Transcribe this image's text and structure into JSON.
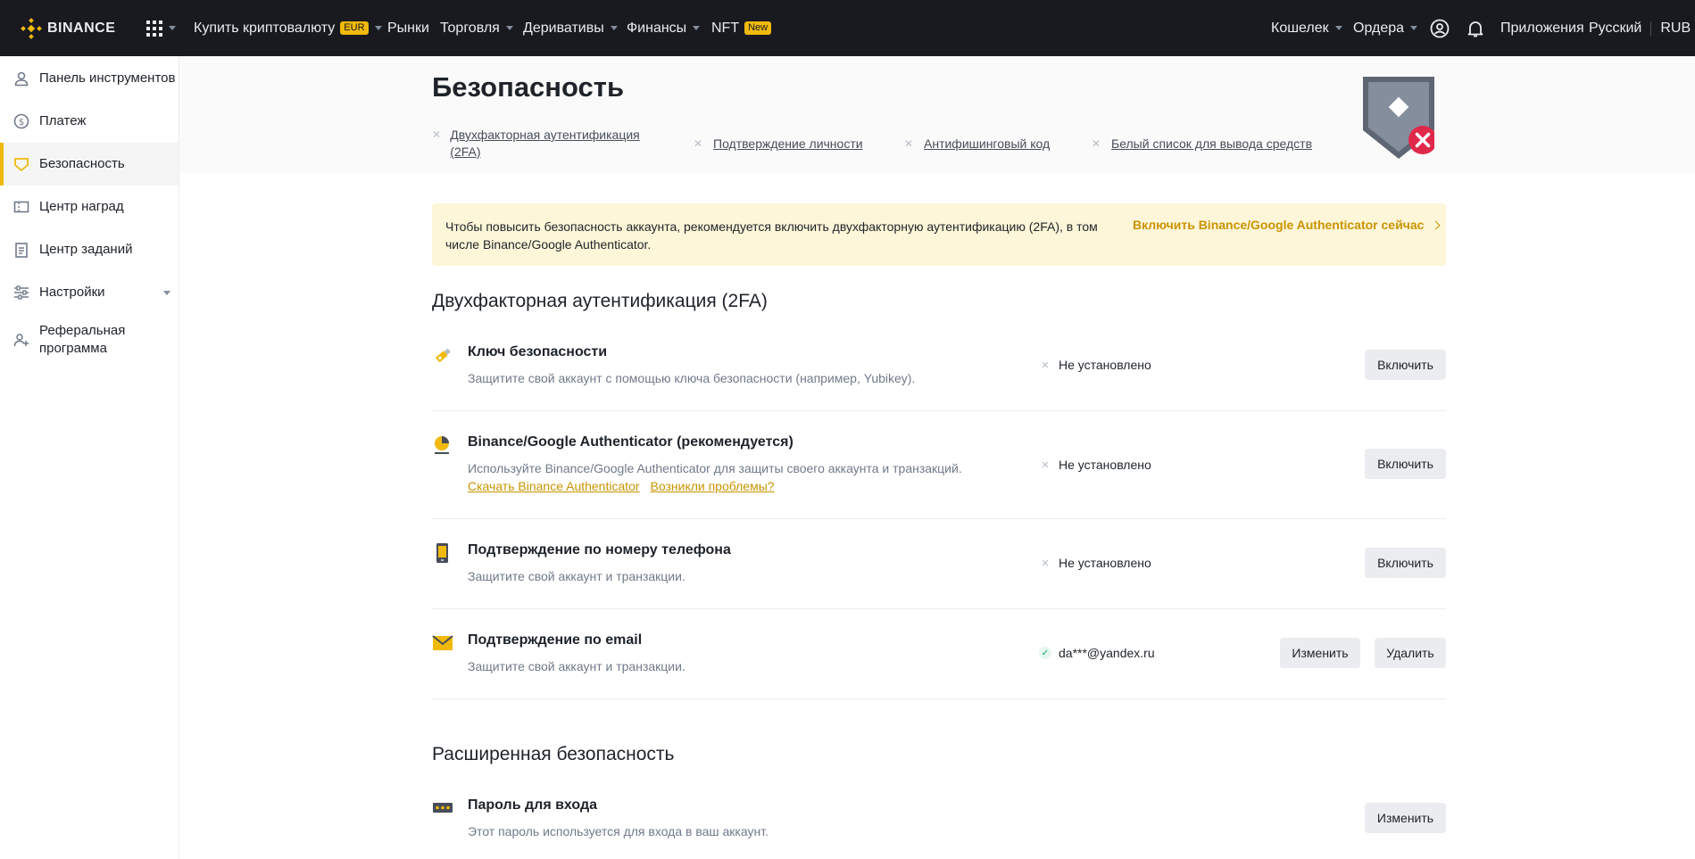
{
  "topbar": {
    "logo_text": "BINANCE",
    "buy_crypto": "Купить криптовалюту",
    "buy_badge": "EUR",
    "markets": "Рынки",
    "trade": "Торговля",
    "derivatives": "Деривативы",
    "finance": "Финансы",
    "nft": "NFT",
    "nft_badge": "New",
    "wallet": "Кошелек",
    "orders": "Ордера",
    "apps": "Приложения",
    "language": "Русский",
    "currency": "RUB",
    "icons": [
      "binance-logo-icon",
      "apps-grid-icon",
      "user-profile-icon",
      "bell-icon"
    ],
    "accent_color": "#f0b90b",
    "bg_color": "#181a20"
  },
  "sidebar": {
    "items": [
      {
        "label": "Панель инструментов",
        "icon": "user-icon"
      },
      {
        "label": "Платеж",
        "icon": "dollar-icon"
      },
      {
        "label": "Безопасность",
        "icon": "shield-icon",
        "active": true
      },
      {
        "label": "Центр наград",
        "icon": "ticket-icon"
      },
      {
        "label": "Центр заданий",
        "icon": "clipboard-icon"
      },
      {
        "label": "Настройки",
        "icon": "sliders-icon"
      },
      {
        "label": "Реферальная программа",
        "icon": "user-plus-icon"
      }
    ]
  },
  "header": {
    "title": "Безопасность",
    "links": [
      {
        "label": "Двухфакторная аутентификация (2FA)"
      },
      {
        "label": "Подтверждение личности"
      },
      {
        "label": "Антифишинговый код"
      },
      {
        "label": "Белый список для вывода средств"
      }
    ],
    "status_icon": "shield-warning-icon"
  },
  "banner": {
    "text": "Чтобы повысить безопасность аккаунта, рекомендуется включить двухфакторную аутентификацию (2FA), в том числе Binance/Google Authenticator.",
    "cta": "Включить Binance/Google Authenticator сейчас"
  },
  "twofa": {
    "title": "Двухфакторная аутентификация (2FA)",
    "rows": [
      {
        "title": "Ключ безопасности",
        "desc": "Защитите свой аккаунт с помощью ключа безопасности (например, Yubikey).",
        "status": "Не установлено",
        "button": "Включить",
        "icon": "usb-key-icon"
      },
      {
        "title": "Binance/Google Authenticator (рекомендуется)",
        "desc": "Используйте Binance/Google Authenticator для защиты своего аккаунта и транзакций.",
        "link1": "Скачать Binance Authenticator",
        "link2": "Возникли проблемы?",
        "status": "Не установлено",
        "button": "Включить",
        "icon": "authenticator-icon"
      },
      {
        "title": "Подтверждение по номеру телефона",
        "desc": "Защитите свой аккаунт и транзакции.",
        "status": "Не установлено",
        "button": "Включить",
        "icon": "phone-icon"
      },
      {
        "title": "Подтверждение по email",
        "desc": "Защитите свой аккаунт и транзакции.",
        "status": "da***@yandex.ru",
        "button": "Изменить",
        "button2": "Удалить",
        "icon": "email-icon"
      }
    ]
  },
  "advanced": {
    "title": "Расширенная безопасность",
    "rows": [
      {
        "title": "Пароль для входа",
        "desc": "Этот пароль используется для входа в ваш аккаунт.",
        "button": "Изменить",
        "icon": "password-icon"
      }
    ]
  }
}
